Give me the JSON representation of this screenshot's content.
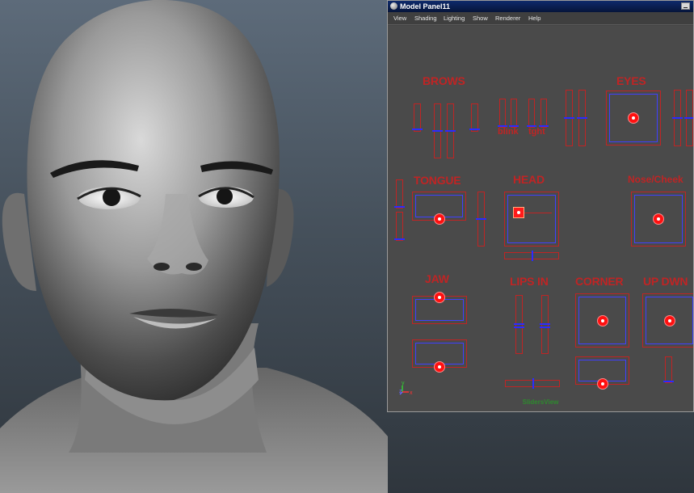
{
  "panel": {
    "title": "Model Panel11",
    "menu": [
      "View",
      "Shading",
      "Lighting",
      "Show",
      "Renderer",
      "Help"
    ],
    "view_name": "SlidersView"
  },
  "controls": {
    "brows": "BROWS",
    "eyes": "EYES",
    "blink": "blink",
    "tight": "tght",
    "tongue": "TONGUE",
    "head": "HEAD",
    "nose_cheek": "Nose/Cheek",
    "jaw": "JAW",
    "lips_in": "LIPS IN",
    "corner": "CORNER",
    "up_down": "UP DWN"
  },
  "axis": {
    "y": "y",
    "z": "z",
    "x": "x"
  }
}
